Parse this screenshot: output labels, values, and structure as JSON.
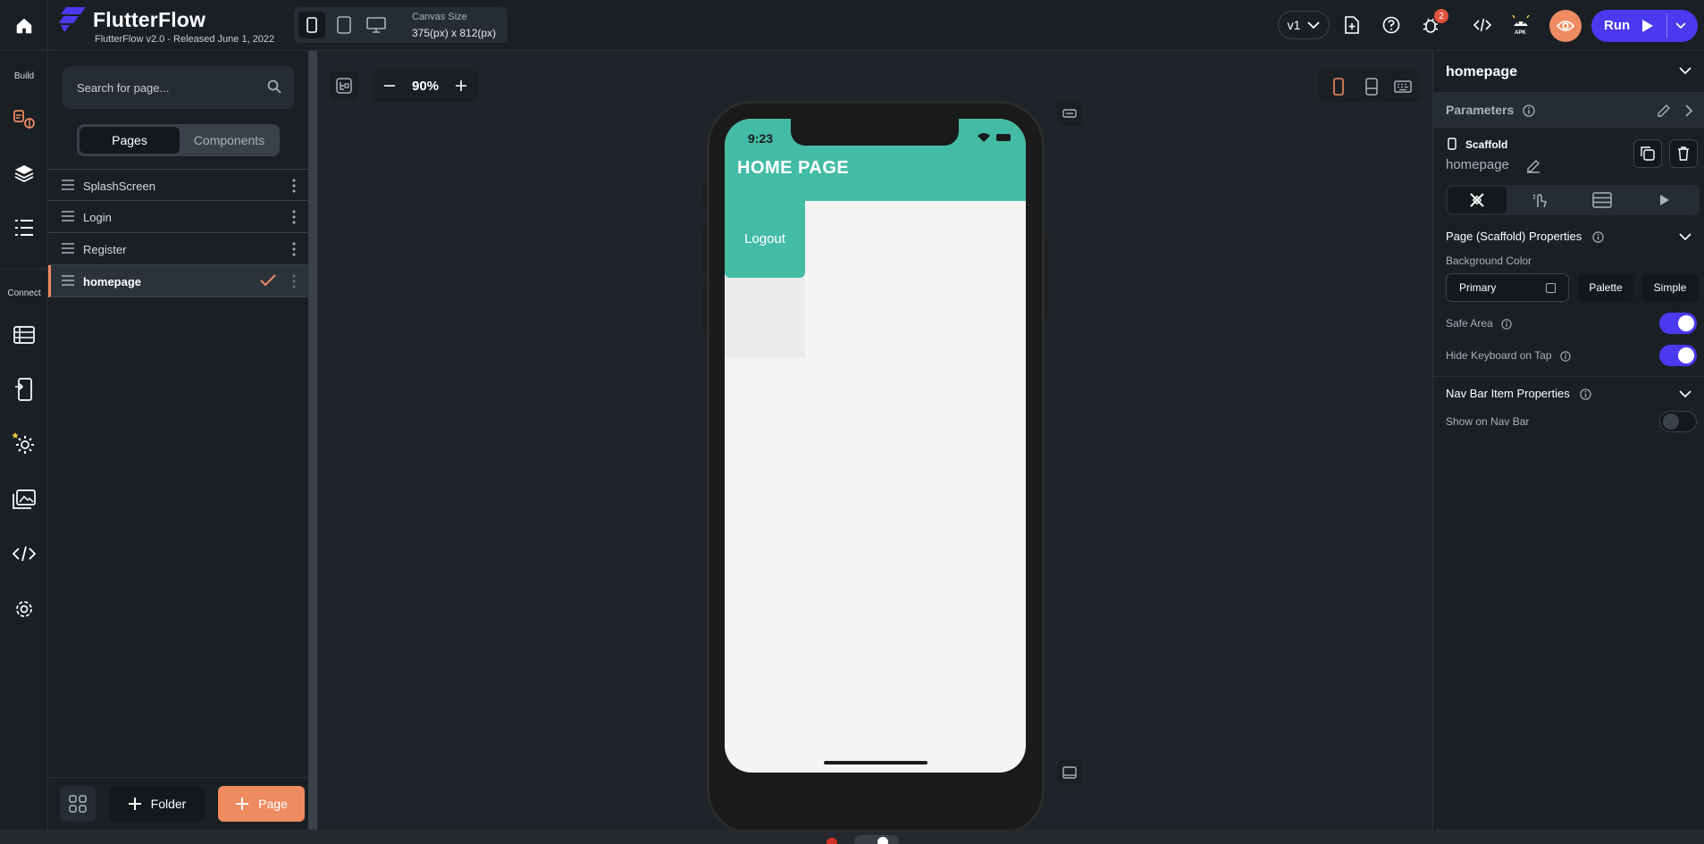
{
  "brand": {
    "name": "FlutterFlow",
    "version_text": "FlutterFlow v2.0 - Released June 1, 2022"
  },
  "toolbar": {
    "canvas_size_label": "Canvas Size",
    "canvas_size_value": "375(px) x 812(px)",
    "version_label": "v1",
    "notification_count": "2",
    "apk_label": "APK",
    "run_label": "Run"
  },
  "rail": {
    "build_label": "Build",
    "connect_label": "Connect"
  },
  "pages_panel": {
    "search_placeholder": "Search for page...",
    "tabs": [
      "Pages",
      "Components"
    ],
    "pages": [
      {
        "name": "SplashScreen"
      },
      {
        "name": "Login"
      },
      {
        "name": "Register"
      },
      {
        "name": "homepage"
      }
    ],
    "folder_label": "Folder",
    "page_label": "Page"
  },
  "canvas": {
    "zoom": "90%"
  },
  "phone": {
    "status_time": "9:23",
    "app_title": "HOME PAGE",
    "logout_label": "Logout",
    "appbar_color": "#44bca5"
  },
  "properties": {
    "page_title": "homepage",
    "parameters_label": "Parameters",
    "widget_type": "Scaffold",
    "widget_name": "homepage",
    "section_page": "Page (Scaffold) Properties",
    "background_color_label": "Background Color",
    "background_color_value": "Primary",
    "palette_label": "Palette",
    "simple_label": "Simple",
    "safe_area_label": "Safe Area",
    "safe_area_on": true,
    "hide_keyboard_label": "Hide Keyboard on Tap",
    "hide_keyboard_on": true,
    "section_nav": "Nav Bar Item Properties",
    "show_nav_label": "Show on Nav Bar",
    "show_nav_on": false
  },
  "colors": {
    "accent": "#4b39ef",
    "orange": "#ee8b60",
    "teal": "#44bca5"
  }
}
